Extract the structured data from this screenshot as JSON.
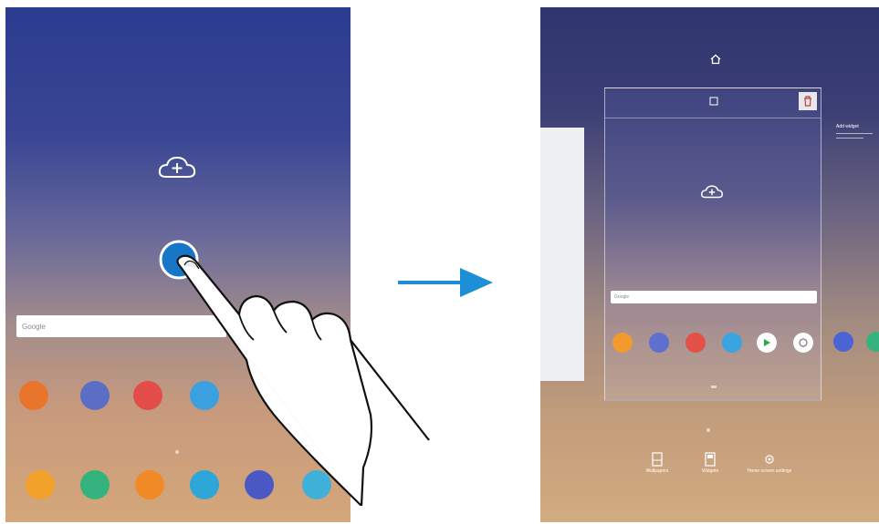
{
  "left_screen": {
    "search_placeholder": "Google",
    "apps_row1": [
      {
        "icon": "galaxy-apps-icon",
        "color": "#e9742b"
      },
      {
        "icon": "calendar-icon",
        "color": "#5b6ec4"
      },
      {
        "icon": "email-icon",
        "color": "#e24d4a"
      },
      {
        "icon": "galaxy-store-icon",
        "color": "#3aa0e0"
      }
    ],
    "apps_row2": [
      {
        "icon": "my-files-icon",
        "color": "#f2a22b"
      },
      {
        "icon": "phone-icon",
        "color": "#35b37e"
      },
      {
        "icon": "contacts-icon",
        "color": "#f08a27"
      },
      {
        "icon": "gallery-icon",
        "color": "#2ea6d8"
      },
      {
        "icon": "internet-icon",
        "color": "#4a59c4"
      },
      {
        "icon": "camera-icon",
        "color": "#3fb0d8"
      }
    ]
  },
  "right_screen": {
    "card_search_placeholder": "Google",
    "right_card_title": "Add widget",
    "card_apps": [
      {
        "icon": "app-icon-1",
        "color": "#f29a2e"
      },
      {
        "icon": "app-icon-2",
        "color": "#5f6fd0"
      },
      {
        "icon": "app-icon-3",
        "color": "#e25048"
      },
      {
        "icon": "app-icon-4",
        "color": "#3aa4e0"
      },
      {
        "icon": "play-store-icon",
        "color": "#ffffff"
      },
      {
        "icon": "app-icon-6",
        "color": "#ffffff"
      }
    ],
    "right_apps": [
      {
        "icon": "messages-icon",
        "color": "#4a64d6"
      },
      {
        "icon": "app-icon-8",
        "color": "#35b37e"
      }
    ],
    "bottom_buttons": [
      {
        "label": "Wallpapers"
      },
      {
        "label": "Widgets"
      },
      {
        "label": "Home screen settings"
      }
    ]
  },
  "colors": {
    "arrow": "#1d8fd6"
  }
}
